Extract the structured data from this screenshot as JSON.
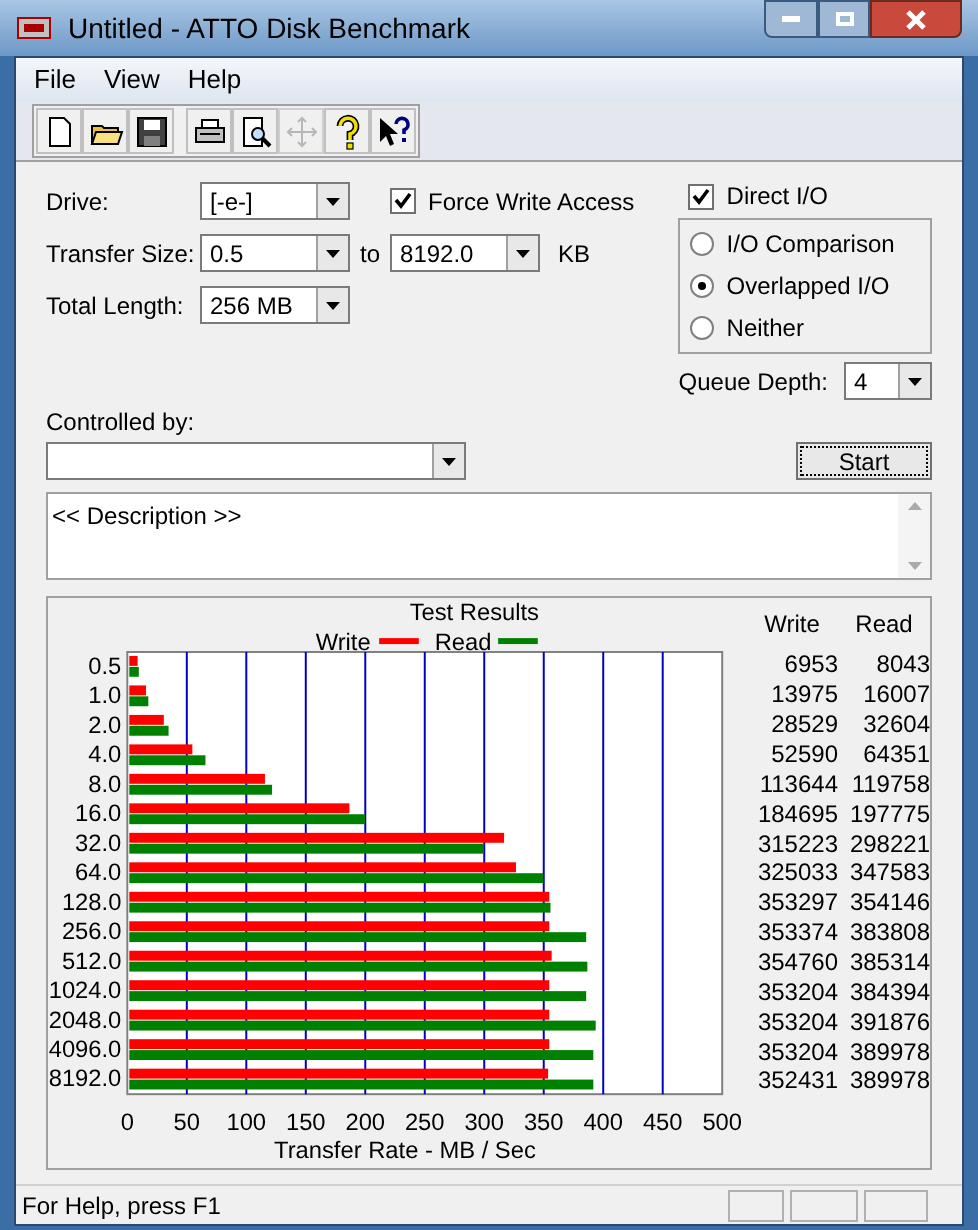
{
  "window": {
    "title": "Untitled - ATTO Disk Benchmark"
  },
  "menu": [
    "File",
    "View",
    "Help"
  ],
  "toolbar": [
    {
      "kind": "new",
      "disabled": false
    },
    {
      "kind": "open",
      "disabled": false
    },
    {
      "kind": "save",
      "disabled": false
    },
    {
      "kind": "print",
      "disabled": false
    },
    {
      "kind": "preview",
      "disabled": false
    },
    {
      "kind": "move",
      "disabled": true
    },
    {
      "kind": "help",
      "disabled": false
    },
    {
      "kind": "context-help",
      "disabled": false
    }
  ],
  "drive": {
    "label": "Drive:",
    "value": "[-e-]"
  },
  "transfer_size": {
    "label": "Transfer Size:",
    "from": "0.5",
    "to_label": "to",
    "to": "8192.0",
    "unit": "KB"
  },
  "total_length": {
    "label": "Total Length:",
    "value": "256 MB"
  },
  "force_write_access": {
    "label": "Force Write Access",
    "checked": true
  },
  "direct_io": {
    "label": "Direct I/O",
    "checked": true
  },
  "io_modes": [
    {
      "label": "I/O Comparison",
      "selected": false
    },
    {
      "label": "Overlapped I/O",
      "selected": true
    },
    {
      "label": "Neither",
      "selected": false
    }
  ],
  "queue_depth": {
    "label": "Queue Depth:",
    "value": "4"
  },
  "controlled_by": {
    "label": "Controlled by:"
  },
  "start_button": "Start",
  "description": "<< Description >>",
  "results": {
    "chart_data": {
      "type": "bar",
      "orientation": "horizontal",
      "title": "Test Results",
      "xlabel": "Transfer Rate - MB / Sec",
      "categories": [
        "0.5",
        "1.0",
        "2.0",
        "4.0",
        "8.0",
        "16.0",
        "32.0",
        "64.0",
        "128.0",
        "256.0",
        "512.0",
        "1024.0",
        "2048.0",
        "4096.0",
        "8192.0"
      ],
      "series": [
        {
          "name": "Write",
          "color": "#ff0000",
          "values": [
            7,
            14,
            29,
            53,
            114,
            185,
            315,
            325,
            353,
            353,
            355,
            353,
            353,
            353,
            352
          ]
        },
        {
          "name": "Read",
          "color": "#008000",
          "values": [
            8,
            16,
            33,
            64,
            120,
            198,
            298,
            348,
            354,
            384,
            385,
            384,
            392,
            390,
            390
          ]
        }
      ],
      "grid": true,
      "legend": true,
      "xlim": [
        0,
        500
      ],
      "xticks": [
        0,
        50,
        100,
        150,
        200,
        250,
        300,
        350,
        400,
        450,
        500
      ]
    },
    "columns": [
      "Write",
      "Read"
    ],
    "rows": [
      [
        "6953",
        "8043"
      ],
      [
        "13975",
        "16007"
      ],
      [
        "28529",
        "32604"
      ],
      [
        "52590",
        "64351"
      ],
      [
        "113644",
        "119758"
      ],
      [
        "184695",
        "197775"
      ],
      [
        "315223",
        "298221"
      ],
      [
        "325033",
        "347583"
      ],
      [
        "353297",
        "354146"
      ],
      [
        "353374",
        "383808"
      ],
      [
        "354760",
        "385314"
      ],
      [
        "353204",
        "384394"
      ],
      [
        "353204",
        "391876"
      ],
      [
        "353204",
        "389978"
      ],
      [
        "352431",
        "389978"
      ]
    ]
  },
  "status_bar": "For Help, press F1"
}
